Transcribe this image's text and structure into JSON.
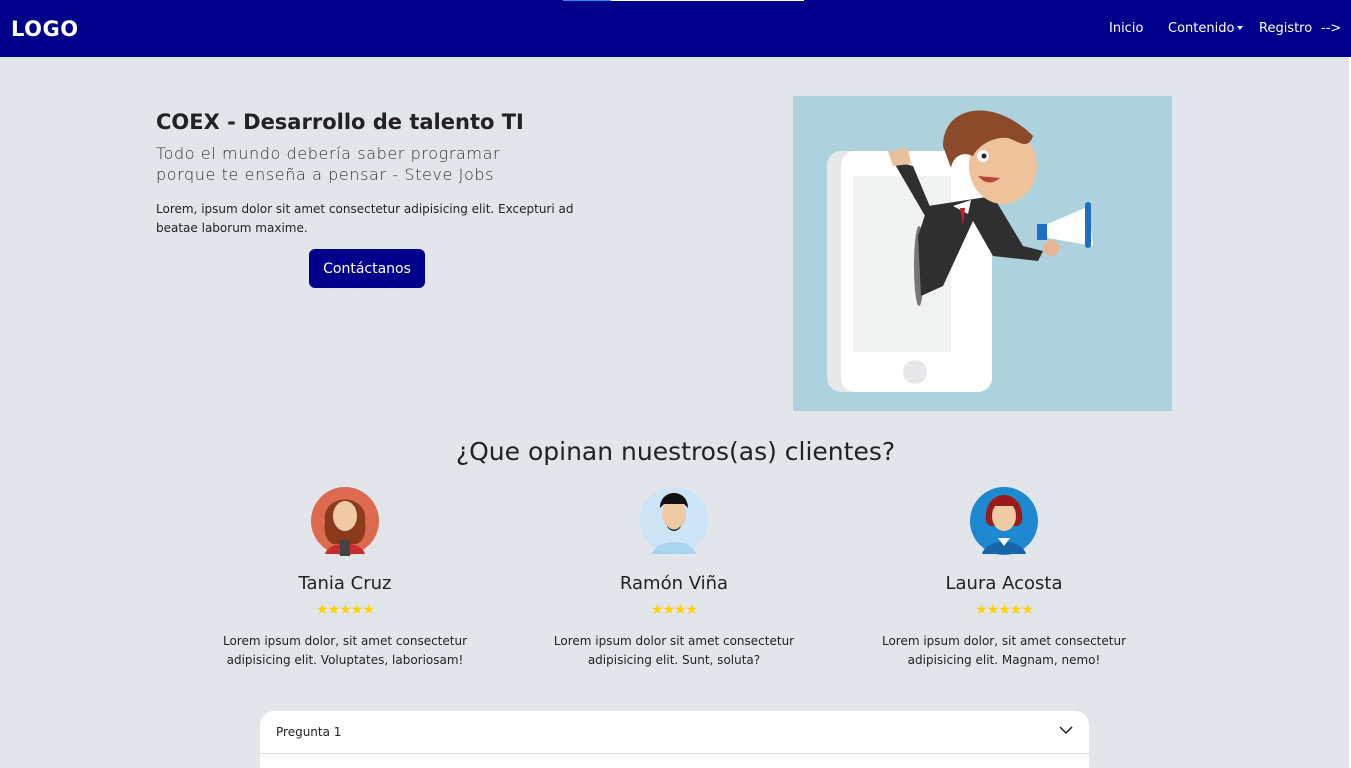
{
  "nav": {
    "logo": "LOGO",
    "links": [
      "Inicio",
      "Contenido",
      "Registro",
      "-->"
    ],
    "progress": 0.2
  },
  "hero": {
    "title": "COEX - Desarrollo de talento TI",
    "quote": "Todo el mundo debería saber programar porque te enseña a pensar - Steve Jobs",
    "text": "Lorem, ipsum dolor sit amet consectetur adipisicing elit. Excepturi ad beatae laborum maxime.",
    "button": "Contáctanos",
    "image_icon": "businessman-megaphone-phone-illustration"
  },
  "testimonials": {
    "title": "¿Que opinan nuestros(as) clientes?",
    "clients": [
      {
        "name": "Tania Cruz",
        "rating": 5,
        "stars": "★★★★★",
        "text": "Lorem ipsum dolor, sit amet consectetur adipisicing elit. Voluptates, laboriosam!",
        "avatar": "woman-curly-hair-avatar"
      },
      {
        "name": "Ramón Viña",
        "rating": 4,
        "stars": "★★★★",
        "text": "Lorem ipsum dolor sit amet consectetur adipisicing elit. Sunt, soluta?",
        "avatar": "man-beard-avatar"
      },
      {
        "name": "Laura Acosta",
        "rating": 5,
        "stars": "★★★★★",
        "text": "Lorem ipsum dolor, sit amet consectetur adipisicing elit. Magnam, nemo!",
        "avatar": "woman-red-hair-avatar"
      }
    ]
  },
  "faq": {
    "items": [
      {
        "label": "Pregunta 1",
        "icon": "chevron-down-icon"
      }
    ]
  },
  "colors": {
    "navbar": "#00008b",
    "background": "#e2e5ea",
    "stars": "#ffd200",
    "image_bg": "#add1dd"
  }
}
